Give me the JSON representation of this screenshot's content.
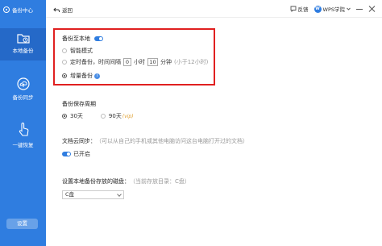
{
  "app": {
    "title": "备份中心"
  },
  "sidebar": {
    "items": [
      {
        "label": "本地备份"
      },
      {
        "label": "备份同步"
      },
      {
        "label": "一键恢复"
      }
    ],
    "settings_label": "设置"
  },
  "topbar": {
    "back_label": "返回",
    "feedback_label": "反馈",
    "account_label": "WPS学院",
    "avatar_text": "W"
  },
  "local_backup": {
    "title": "备份至本地",
    "enabled": true,
    "options": {
      "smart": "智能模式",
      "timed_prefix": "定时备份，时间间隔",
      "hours_value": "0",
      "hours_unit": "小时",
      "minutes_value": "10",
      "minutes_unit": "分钟",
      "timed_hint": "(小于12小时)",
      "incremental": "增量备份",
      "info_glyph": "i"
    },
    "selected": "incremental"
  },
  "retention": {
    "title": "备份保存周期",
    "option_30": "30天",
    "option_90": "90天",
    "vip_badge": "vip",
    "selected": "30天"
  },
  "cloud_sync": {
    "title": "文档云同步：",
    "hint": "（可以从自己的手机或其他电脑访问这台电脑打开过的文档）",
    "status_label": "已开启",
    "enabled": true
  },
  "disk": {
    "title": "设置本地备份存放的磁盘：",
    "current_hint": "（当前存放目录：C盘）",
    "selected_value": "C盘"
  },
  "colors": {
    "sidebar": "#2f7de0",
    "accent": "#2f7de0",
    "highlight_border": "#e02020"
  }
}
